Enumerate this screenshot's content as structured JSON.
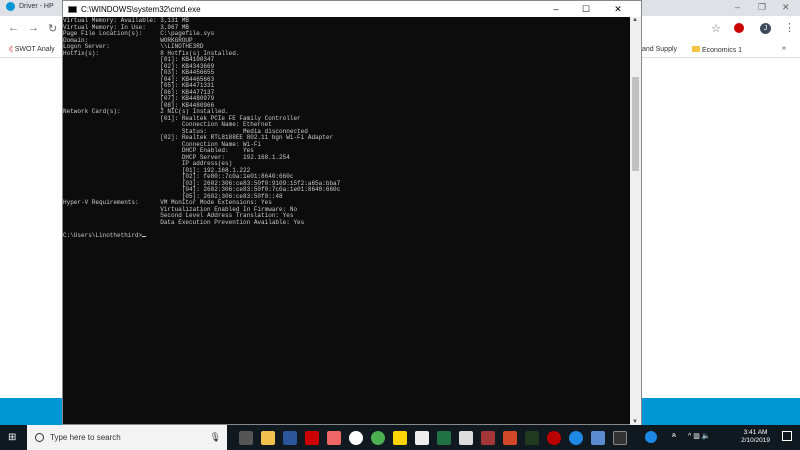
{
  "browser": {
    "tab_title": "Driver - HP",
    "bookmarks": [
      "SWOT Analy",
      "and Supply",
      "Economics 1"
    ],
    "profile_initial": "J",
    "more": "»"
  },
  "cmd": {
    "title": "C:\\WINDOWS\\system32\\cmd.exe",
    "minimize": "–",
    "maximize": "☐",
    "close": "✕",
    "lines": [
      "Virtual Memory: Available: 3,131 MB",
      "Virtual Memory: In Use:    3,967 MB",
      "Page File Location(s):     C:\\pagefile.sys",
      "Domain:                    WORKGROUP",
      "Logon Server:              \\\\LINOTHE3RD",
      "Hotfix(s):                 8 Hotfix(s) Installed.",
      "                           [01]: KB4100347",
      "                           [02]: KB4343669",
      "                           [03]: KB4456655",
      "                           [04]: KB4465663",
      "                           [05]: KB4471331",
      "                           [06]: KB4477137",
      "                           [07]: KB4480979",
      "                           [08]: KB4480966",
      "Network Card(s):           2 NIC(s) Installed.",
      "                           [01]: Realtek PCIe FE Family Controller",
      "                                 Connection Name: Ethernet",
      "                                 Status:          Media disconnected",
      "                           [02]: Realtek RTL8188EE 802.11 bgn Wi-Fi Adapter",
      "                                 Connection Name: Wi-Fi",
      "                                 DHCP Enabled:    Yes",
      "                                 DHCP Server:     192.168.1.254",
      "                                 IP address(es)",
      "                                 [01]: 192.168.1.222",
      "                                 [02]: fe80::7c0a:1e01:8640:660c",
      "                                 [03]: 2602:306:ce83:50f0:9109:15f2:a65a:bba7",
      "                                 [04]: 2602:306:ce83:50f0:7c0a:1e01:8640:660c",
      "                                 [05]: 2602:306:ce83:50f0::48",
      "Hyper-V Requirements:      VM Monitor Mode Extensions: Yes",
      "                           Virtualization Enabled In Firmware: No",
      "                           Second Level Address Translation: Yes",
      "                           Data Execution Prevention Available: Yes",
      "",
      "C:\\Users\\Linothethird>"
    ]
  },
  "taskbar": {
    "search_placeholder": "Type here to search",
    "time": "3:41 AM",
    "date": "2/10/2019"
  }
}
